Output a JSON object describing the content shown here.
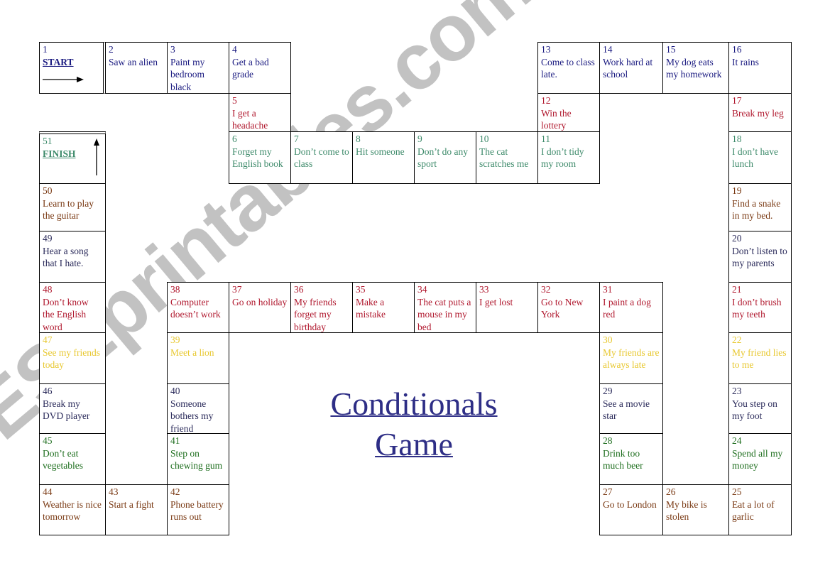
{
  "title": {
    "line1": "Conditionals",
    "line2": "Game"
  },
  "watermark": "ESLprintables.com",
  "colors": {
    "navy": "#1a1a80",
    "red": "#b0182e",
    "teal": "#3d8a6a",
    "brown": "#7a3a14",
    "dark": "#2a2a5a",
    "yellow": "#e8c830",
    "green": "#1e6e1e",
    "title": "#2e2e86"
  },
  "cells": [
    {
      "n": "1",
      "label": "START",
      "text": "",
      "icon": "arrow-right-icon"
    },
    {
      "n": "2",
      "text": "Saw an alien"
    },
    {
      "n": "3",
      "text": "Paint my bedroom black"
    },
    {
      "n": "4",
      "text": "Get a bad grade"
    },
    {
      "n": "5",
      "text": "I get a headache"
    },
    {
      "n": "6",
      "text": "Forget my English book"
    },
    {
      "n": "7",
      "text": "Don’t come to  class"
    },
    {
      "n": "8",
      "text": "Hit someone"
    },
    {
      "n": "9",
      "text": "Don’t do any sport"
    },
    {
      "n": "10",
      "text": "The cat scratches me"
    },
    {
      "n": "11",
      "text": "I don’t tidy my room"
    },
    {
      "n": "12",
      "text": "Win the lottery"
    },
    {
      "n": "13",
      "text": "Come to class late."
    },
    {
      "n": "14",
      "text": "Work hard at school"
    },
    {
      "n": "15",
      "text": "My dog eats my homework"
    },
    {
      "n": "16",
      "text": "It rains"
    },
    {
      "n": "17",
      "text": "Break my leg"
    },
    {
      "n": "18",
      "text": "I don’t have lunch"
    },
    {
      "n": "19",
      "text": "Find a snake in my bed."
    },
    {
      "n": "20",
      "text": "Don’t listen to my parents"
    },
    {
      "n": "21",
      "text": "I don’t brush my teeth"
    },
    {
      "n": "22",
      "text": "My friend lies to me"
    },
    {
      "n": "23",
      "text": "You step on my foot"
    },
    {
      "n": "24",
      "text": "Spend all my money"
    },
    {
      "n": "25",
      "text": "Eat a lot of garlic"
    },
    {
      "n": "26",
      "text": "My bike is stolen"
    },
    {
      "n": "27",
      "text": "Go to London"
    },
    {
      "n": "28",
      "text": "Drink too much beer"
    },
    {
      "n": "29",
      "text": "See a movie star"
    },
    {
      "n": "30",
      "text": "My friends are always late"
    },
    {
      "n": "31",
      "text": "I paint a dog red"
    },
    {
      "n": "32",
      "text": "Go to New York"
    },
    {
      "n": "33",
      "text": "I get lost"
    },
    {
      "n": "34",
      "text": "The cat puts a mouse in my bed"
    },
    {
      "n": "35",
      "text": "Make a mistake"
    },
    {
      "n": "36",
      "text": "My friends forget my birthday"
    },
    {
      "n": "37",
      "text": "Go on holiday"
    },
    {
      "n": "38",
      "text": "Computer doesn’t work"
    },
    {
      "n": "39",
      "text": "Meet a lion"
    },
    {
      "n": "40",
      "text": "Someone bothers my friend"
    },
    {
      "n": "41",
      "text": "Step on chewing gum"
    },
    {
      "n": "42",
      "text": "Phone battery runs out"
    },
    {
      "n": "43",
      "text": "Start a fight"
    },
    {
      "n": "44",
      "text": "Weather is nice tomorrow"
    },
    {
      "n": "45",
      "text": "Don’t eat vegetables"
    },
    {
      "n": "46",
      "text": "Break my DVD player"
    },
    {
      "n": "47",
      "text": "See my friends today"
    },
    {
      "n": "48",
      "text": "Don’t know the English word"
    },
    {
      "n": "49",
      "text": "Hear a song that I hate."
    },
    {
      "n": "50",
      "text": "Learn to play the guitar"
    },
    {
      "n": "51",
      "label": "FINISH",
      "text": "",
      "icon": "arrow-up-icon"
    }
  ]
}
